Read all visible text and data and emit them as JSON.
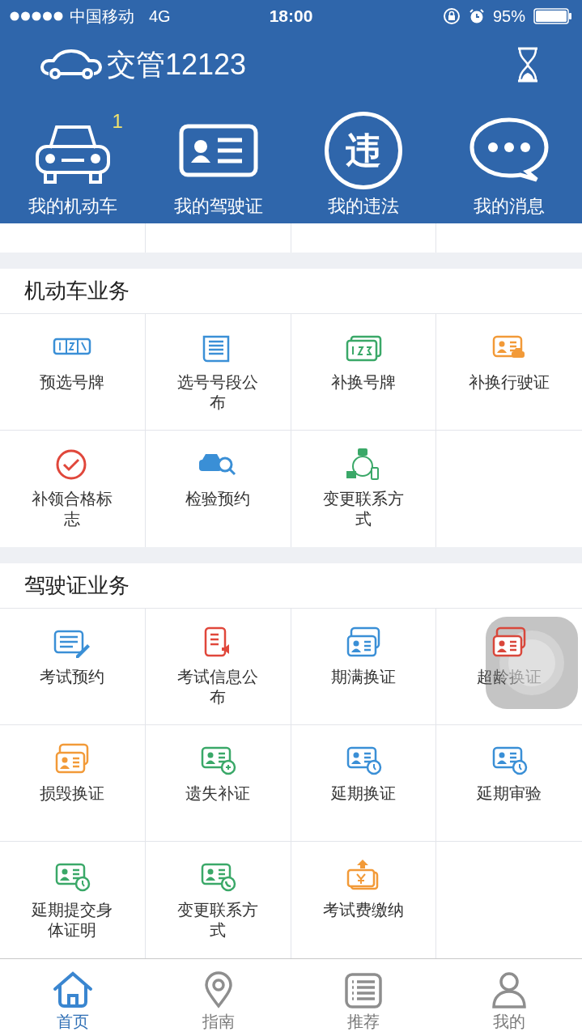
{
  "status_bar": {
    "carrier": "中国移动",
    "network": "4G",
    "time": "18:00",
    "battery": "95%"
  },
  "header": {
    "title": "交管12123"
  },
  "quick_actions": [
    {
      "kind": "car",
      "label": "我的机动车",
      "badge": "1"
    },
    {
      "kind": "license",
      "label": "我的驾驶证"
    },
    {
      "kind": "violation",
      "label": "我的违法",
      "glyph": "违"
    },
    {
      "kind": "message",
      "label": "我的消息"
    }
  ],
  "sections": [
    {
      "title": "机动车业务",
      "items": [
        {
          "label": "预选号牌",
          "kind": "plate",
          "color": "#3a8fd6"
        },
        {
          "label": "选号号段公布",
          "kind": "newspaper",
          "color": "#3a8fd6"
        },
        {
          "label": "补换号牌",
          "kind": "plates",
          "color": "#3aa868"
        },
        {
          "label": "补换行驶证",
          "kind": "permit",
          "color": "#f29a38"
        },
        {
          "label": "补领合格标志",
          "kind": "stamp",
          "color": "#e0473b"
        },
        {
          "label": "检验预约",
          "kind": "inspection",
          "color": "#3a8fd6"
        },
        {
          "label": "变更联系方式",
          "kind": "contact",
          "color": "#3aa868"
        }
      ]
    },
    {
      "title": "驾驶证业务",
      "items": [
        {
          "label": "考试预约",
          "kind": "schedule",
          "color": "#3a8fd6"
        },
        {
          "label": "考试信息公布",
          "kind": "notice",
          "color": "#e0473b"
        },
        {
          "label": "期满换证",
          "kind": "renewal",
          "color": "#3a8fd6"
        },
        {
          "label": "超龄换证",
          "kind": "renewal",
          "color": "#d9473b"
        },
        {
          "label": "损毁换证",
          "kind": "renewal",
          "color": "#f29a38"
        },
        {
          "label": "遗失补证",
          "kind": "reissue",
          "color": "#3aa868"
        },
        {
          "label": "延期换证",
          "kind": "delay",
          "color": "#3a8fd6"
        },
        {
          "label": "延期审验",
          "kind": "delay",
          "color": "#3a8fd6"
        },
        {
          "label": "延期提交身体证明",
          "kind": "delay",
          "color": "#3aa868"
        },
        {
          "label": "变更联系方式",
          "kind": "phone",
          "color": "#3aa868"
        },
        {
          "label": "考试费缴纳",
          "kind": "fee",
          "color": "#f29a38"
        }
      ]
    }
  ],
  "tab_bar": [
    {
      "kind": "home",
      "label": "首页",
      "selected": true
    },
    {
      "kind": "pin",
      "label": "指南",
      "selected": false
    },
    {
      "kind": "list",
      "label": "推荐",
      "selected": false
    },
    {
      "kind": "user",
      "label": "我的",
      "selected": false
    }
  ]
}
